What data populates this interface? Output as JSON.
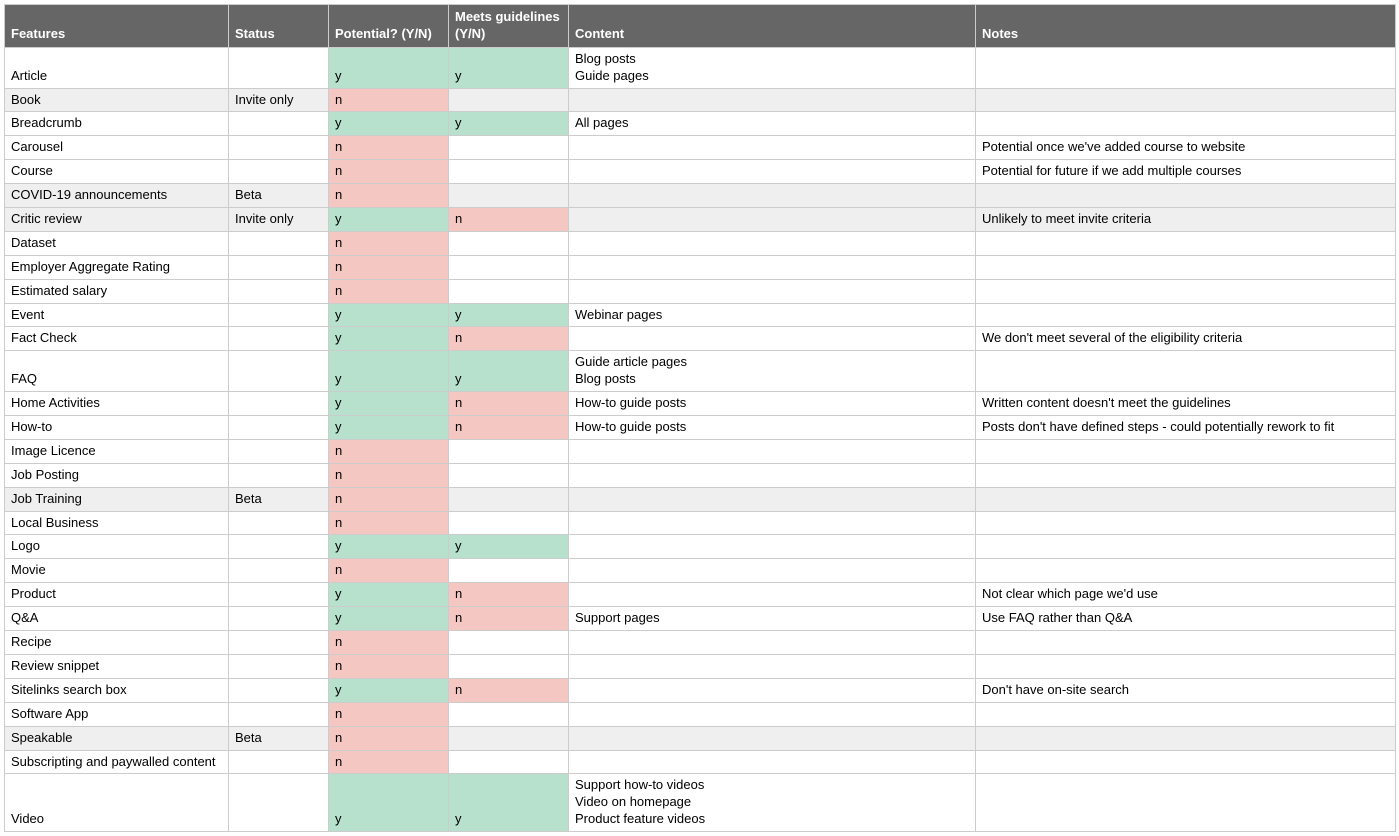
{
  "headers": {
    "features": "Features",
    "status": "Status",
    "potential": "Potential? (Y/N)",
    "guidelines": "Meets guidelines (Y/N)",
    "content": "Content",
    "notes": "Notes"
  },
  "rows": [
    {
      "feature": "Article",
      "status": "",
      "potential": "y",
      "guidelines": "y",
      "content": "Blog posts\nGuide pages",
      "notes": "",
      "alt": false
    },
    {
      "feature": "Book",
      "status": "Invite only",
      "potential": "n",
      "guidelines": "",
      "content": "",
      "notes": "",
      "alt": true
    },
    {
      "feature": "Breadcrumb",
      "status": "",
      "potential": "y",
      "guidelines": "y",
      "content": "All pages",
      "notes": "",
      "alt": false
    },
    {
      "feature": "Carousel",
      "status": "",
      "potential": "n",
      "guidelines": "",
      "content": "",
      "notes": "Potential once we've added course to website",
      "alt": false
    },
    {
      "feature": "Course",
      "status": "",
      "potential": "n",
      "guidelines": "",
      "content": "",
      "notes": "Potential for future if we add multiple courses",
      "alt": false
    },
    {
      "feature": "COVID-19 announcements",
      "status": "Beta",
      "potential": "n",
      "guidelines": "",
      "content": "",
      "notes": "",
      "alt": true
    },
    {
      "feature": "Critic review",
      "status": "Invite only",
      "potential": "y",
      "guidelines": "n",
      "content": "",
      "notes": "Unlikely to meet invite criteria",
      "alt": true
    },
    {
      "feature": "Dataset",
      "status": "",
      "potential": "n",
      "guidelines": "",
      "content": "",
      "notes": "",
      "alt": false
    },
    {
      "feature": "Employer Aggregate Rating",
      "status": "",
      "potential": "n",
      "guidelines": "",
      "content": "",
      "notes": "",
      "alt": false
    },
    {
      "feature": "Estimated salary",
      "status": "",
      "potential": "n",
      "guidelines": "",
      "content": "",
      "notes": "",
      "alt": false
    },
    {
      "feature": "Event",
      "status": "",
      "potential": "y",
      "guidelines": "y",
      "content": "Webinar pages",
      "notes": "",
      "alt": false
    },
    {
      "feature": "Fact Check",
      "status": "",
      "potential": "y",
      "guidelines": "n",
      "content": "",
      "notes": "We don't meet several of the eligibility criteria",
      "alt": false
    },
    {
      "feature": "FAQ",
      "status": "",
      "potential": "y",
      "guidelines": "y",
      "content": "Guide article pages\nBlog posts",
      "notes": "",
      "alt": false
    },
    {
      "feature": "Home Activities",
      "status": "",
      "potential": "y",
      "guidelines": "n",
      "content": "How-to guide posts",
      "notes": "Written content doesn't meet the guidelines",
      "alt": false
    },
    {
      "feature": "How-to",
      "status": "",
      "potential": "y",
      "guidelines": "n",
      "content": "How-to guide posts",
      "notes": "Posts don't have defined steps - could potentially rework to fit",
      "alt": false
    },
    {
      "feature": "Image Licence",
      "status": "",
      "potential": "n",
      "guidelines": "",
      "content": "",
      "notes": "",
      "alt": false
    },
    {
      "feature": "Job Posting",
      "status": "",
      "potential": "n",
      "guidelines": "",
      "content": "",
      "notes": "",
      "alt": false
    },
    {
      "feature": "Job Training",
      "status": "Beta",
      "potential": "n",
      "guidelines": "",
      "content": "",
      "notes": "",
      "alt": true
    },
    {
      "feature": "Local Business",
      "status": "",
      "potential": "n",
      "guidelines": "",
      "content": "",
      "notes": "",
      "alt": false
    },
    {
      "feature": "Logo",
      "status": "",
      "potential": "y",
      "guidelines": "y",
      "content": "",
      "notes": "",
      "alt": false
    },
    {
      "feature": "Movie",
      "status": "",
      "potential": "n",
      "guidelines": "",
      "content": "",
      "notes": "",
      "alt": false
    },
    {
      "feature": "Product",
      "status": "",
      "potential": "y",
      "guidelines": "n",
      "content": "",
      "notes": "Not clear which page we'd use",
      "alt": false
    },
    {
      "feature": "Q&A",
      "status": "",
      "potential": "y",
      "guidelines": "n",
      "content": "Support pages",
      "notes": "Use FAQ rather than Q&A",
      "alt": false
    },
    {
      "feature": "Recipe",
      "status": "",
      "potential": "n",
      "guidelines": "",
      "content": "",
      "notes": "",
      "alt": false
    },
    {
      "feature": "Review snippet",
      "status": "",
      "potential": "n",
      "guidelines": "",
      "content": "",
      "notes": "",
      "alt": false
    },
    {
      "feature": "Sitelinks search box",
      "status": "",
      "potential": "y",
      "guidelines": "n",
      "content": "",
      "notes": "Don't have on-site search",
      "alt": false
    },
    {
      "feature": "Software App",
      "status": "",
      "potential": "n",
      "guidelines": "",
      "content": "",
      "notes": "",
      "alt": false
    },
    {
      "feature": "Speakable",
      "status": "Beta",
      "potential": "n",
      "guidelines": "",
      "content": "",
      "notes": "",
      "alt": true
    },
    {
      "feature": "Subscripting and paywalled content",
      "status": "",
      "potential": "n",
      "guidelines": "",
      "content": "",
      "notes": "",
      "alt": false
    },
    {
      "feature": "Video",
      "status": "",
      "potential": "y",
      "guidelines": "y",
      "content": "Support how-to videos\nVideo on homepage\nProduct feature videos",
      "notes": "",
      "alt": false
    }
  ]
}
